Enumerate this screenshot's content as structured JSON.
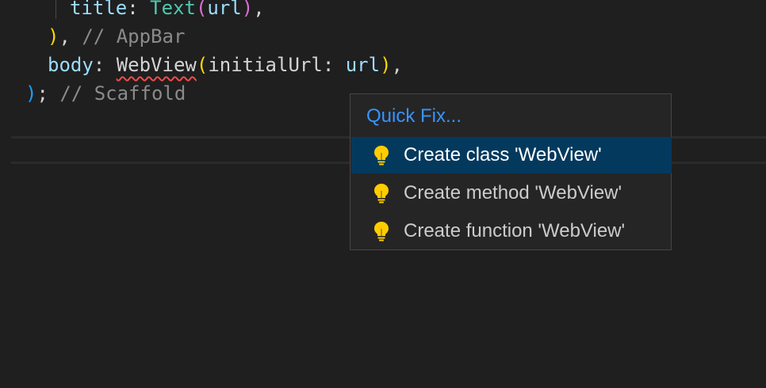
{
  "code": {
    "line1": {
      "prop": "title",
      "colon": ": ",
      "call": "Text",
      "open": "(",
      "arg": "url",
      "close": ")",
      "comma": ","
    },
    "line2": {
      "close": ")",
      "comma": ", ",
      "comment": "// AppBar"
    },
    "line3": {
      "prop": "body",
      "colon": ": ",
      "call": "WebView",
      "open": "(",
      "param": "initialUrl",
      "param_colon": ": ",
      "arg": "url",
      "close": ")",
      "comma": ","
    },
    "line4": {
      "close": ")",
      "semi": "; ",
      "comment": "// Scaffold"
    }
  },
  "quick_fix": {
    "title": "Quick Fix...",
    "items": [
      {
        "label": "Create class 'WebView'",
        "icon": "lightbulb-icon",
        "selected": true
      },
      {
        "label": "Create method 'WebView'",
        "icon": "lightbulb-icon",
        "selected": false
      },
      {
        "label": "Create function 'WebView'",
        "icon": "lightbulb-icon",
        "selected": false
      }
    ],
    "icon_color": "#ffcc00"
  },
  "colors": {
    "background": "#1f1f1f",
    "selection": "#04395e",
    "accent": "#3794ff",
    "error_underline": "#f14c4c"
  }
}
